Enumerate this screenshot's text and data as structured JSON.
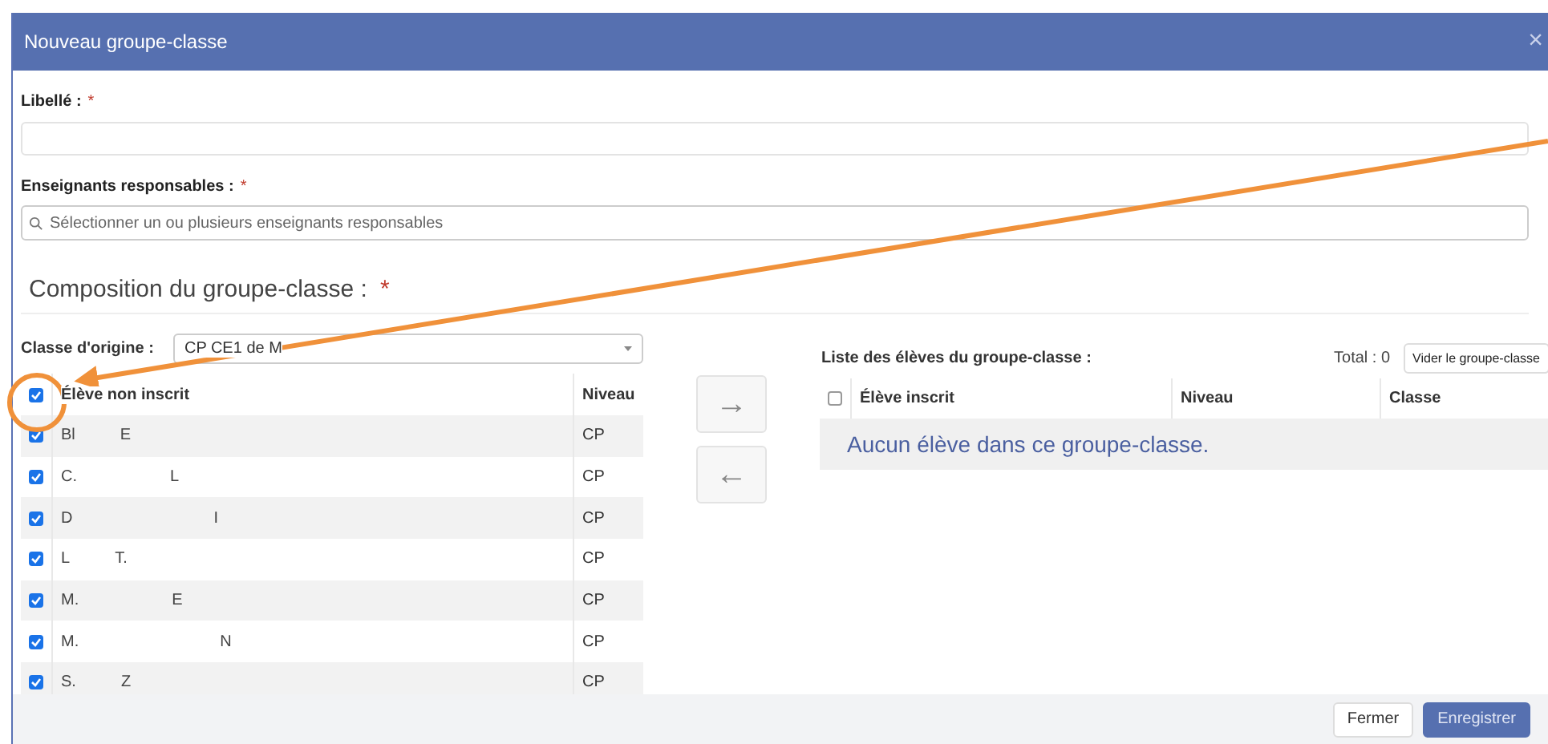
{
  "dialog": {
    "title": "Nouveau groupe-classe",
    "close": "×"
  },
  "libelle": {
    "label": "Libellé :",
    "required": "*"
  },
  "teachers": {
    "label": "Enseignants responsables :",
    "required": "*",
    "placeholder": "Sélectionner un ou plusieurs enseignants responsables"
  },
  "section": {
    "title": "Composition du groupe-classe :",
    "required": "*"
  },
  "origin": {
    "label": "Classe d'origine :",
    "value": "CP CE1 de M"
  },
  "left_table": {
    "header_checked": true,
    "columns": [
      "Élève non inscrit",
      "Niveau"
    ],
    "rows": [
      {
        "name": [
          "Bl",
          "E"
        ],
        "level": "CP",
        "checked": true
      },
      {
        "name": [
          "C.",
          "L"
        ],
        "level": "CP",
        "checked": true
      },
      {
        "name": [
          "D",
          "I"
        ],
        "level": "CP",
        "checked": true
      },
      {
        "name": [
          "L",
          "T."
        ],
        "level": "CP",
        "checked": true
      },
      {
        "name": [
          "M.",
          "E"
        ],
        "level": "CP",
        "checked": true
      },
      {
        "name": [
          "M.",
          "N"
        ],
        "level": "CP",
        "checked": true
      },
      {
        "name": [
          "S.",
          "Z"
        ],
        "level": "CP",
        "checked": true
      }
    ]
  },
  "move_buttons": [
    "→",
    "←"
  ],
  "right_panel": {
    "title": "Liste des élèves du groupe-classe :",
    "total": "Total : 0",
    "clear_button": "Vider le groupe-classe",
    "header_checked": false,
    "columns": [
      "Élève inscrit",
      "Niveau",
      "Classe"
    ],
    "empty_message": "Aucun élève dans ce groupe-classe."
  },
  "footer": {
    "buttons": [
      {
        "label": "Fermer",
        "kind": "default"
      },
      {
        "label": "Enregistrer",
        "kind": "primary"
      }
    ]
  }
}
